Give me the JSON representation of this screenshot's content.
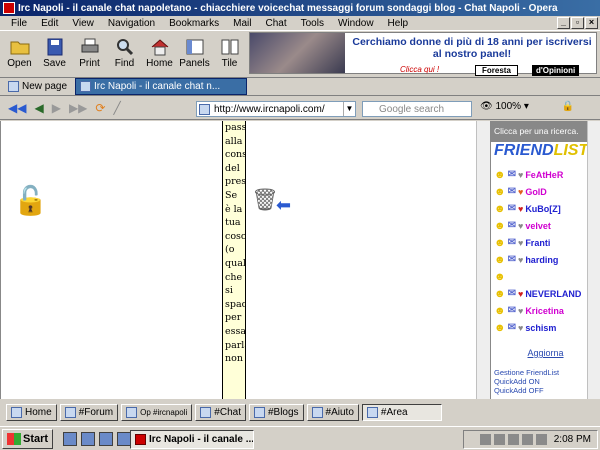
{
  "window": {
    "title": "Irc Napoli - il canale chat napoletano - chiacchiere voicechat messaggi forum sondaggi blog - Chat Napoli - Opera"
  },
  "menu": [
    "File",
    "Edit",
    "View",
    "Navigation",
    "Bookmarks",
    "Mail",
    "Chat",
    "Tools",
    "Window",
    "Help"
  ],
  "toolbar": [
    {
      "label": "Open",
      "icon": "folder-icon"
    },
    {
      "label": "Save",
      "icon": "floppy-icon"
    },
    {
      "label": "Print",
      "icon": "printer-icon"
    },
    {
      "label": "Find",
      "icon": "magnifier-icon"
    },
    {
      "label": "Home",
      "icon": "house-icon"
    },
    {
      "label": "Panels",
      "icon": "panels-icon"
    },
    {
      "label": "Tile",
      "icon": "tile-icon"
    }
  ],
  "banner": {
    "headline": "Cerchiamo donne di più di 18 anni per iscriversi al nostro panel!",
    "cta": "Clicca qui !",
    "brand1": "Foresta",
    "brand2": "d'Opinioni"
  },
  "tabs": {
    "new_page": "New page",
    "active": "Irc Napoli - il canale chat n..."
  },
  "address": {
    "url": "http://www.ircnapoli.com/",
    "search_placeholder": "Google search",
    "zoom": "100%"
  },
  "page": {
    "column_words": [
      "pass",
      "alla",
      "cons",
      "del",
      "pres",
      "Se",
      "è la",
      "tua",
      "cosc",
      "(o",
      "qual",
      "che",
      "si",
      "spac",
      "per",
      "essa",
      "parla",
      "non"
    ]
  },
  "sidebar": {
    "header": "Clicca per una ricerca.",
    "logo_a": "FRIEND",
    "logo_b": "LIST",
    "friends": [
      {
        "name": "FeAtHeR",
        "color": "#d000d0",
        "heart": "#888888"
      },
      {
        "name": "GolD",
        "color": "#d000d0",
        "heart": "#e06020"
      },
      {
        "name": "KuBo[Z]",
        "color": "#2020d0",
        "heart": "#d02020"
      },
      {
        "name": "velvet",
        "color": "#d000d0",
        "heart": "#888888"
      },
      {
        "name": "Franti",
        "color": "#2020d0",
        "heart": "#888888"
      },
      {
        "name": "harding",
        "color": "#2020d0",
        "heart": "#888888"
      },
      {
        "name": "",
        "color": "#000000",
        "heart": ""
      },
      {
        "name": "NEVERLAND",
        "color": "#2020d0",
        "heart": "#d02020"
      },
      {
        "name": "Kricetina",
        "color": "#d000d0",
        "heart": "#888888"
      },
      {
        "name": "schism",
        "color": "#2020d0",
        "heart": "#888888"
      }
    ],
    "update_link": "Aggiorna",
    "footer1": "Gestione FriendList",
    "footer2": "QuickAdd ON",
    "footer3": "QuickAdd OFF"
  },
  "page_tabs": [
    "Home",
    "#Forum",
    "Op #ircnapoli",
    "#Chat",
    "#Blogs",
    "#Aiuto",
    "#Area"
  ],
  "taskbar": {
    "start": "Start",
    "task": "Irc Napoli - il canale ...",
    "clock": "2:08 PM"
  }
}
